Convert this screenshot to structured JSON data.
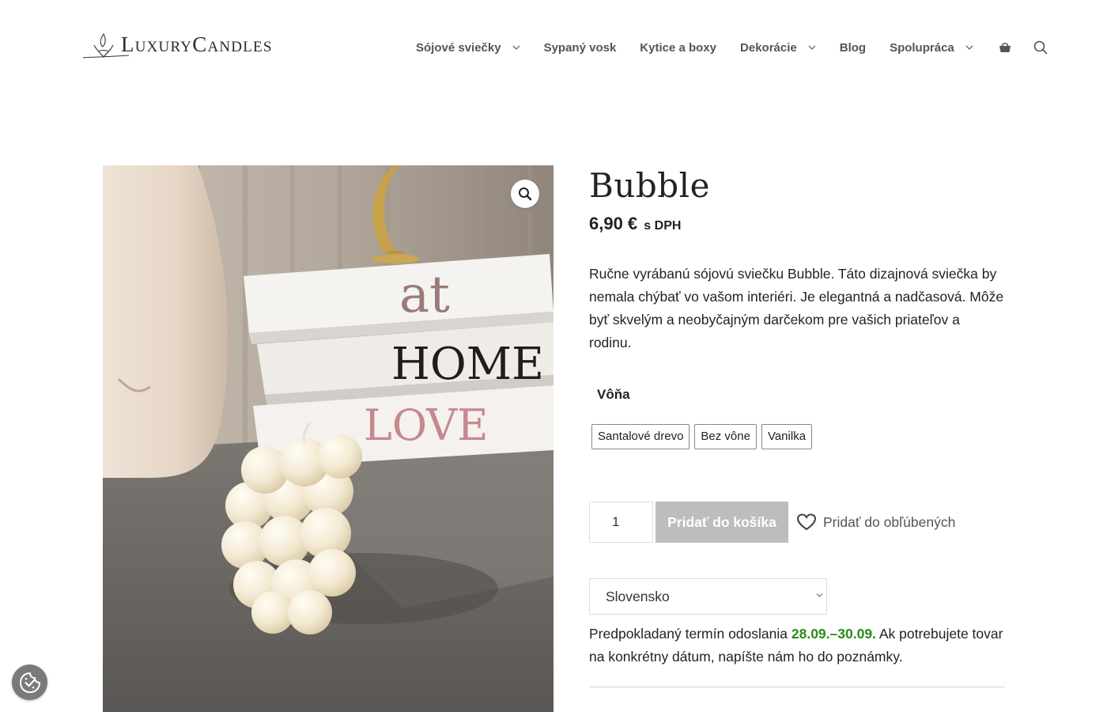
{
  "brand": {
    "logo_text": "LuxuryCandles"
  },
  "nav": {
    "items": [
      {
        "label": "Sójové sviečky",
        "has_dropdown": true
      },
      {
        "label": "Sypaný vosk",
        "has_dropdown": false
      },
      {
        "label": "Kytice a boxy",
        "has_dropdown": false
      },
      {
        "label": "Dekorácie",
        "has_dropdown": true
      },
      {
        "label": "Blog",
        "has_dropdown": false
      },
      {
        "label": "Spolupráca",
        "has_dropdown": true
      }
    ],
    "icons": [
      "shopping-basket-icon",
      "search-icon"
    ]
  },
  "product": {
    "title": "Bubble",
    "price": "6,90 €",
    "price_suffix": "s DPH",
    "description": "Ručne vyrábanú sójovú sviečku Bubble. Táto dizajnová sviečka by nemala chýbať vo vašom interiéri. Je elegantná a nadčasová. Môže byť skvelým a neobyčajným darčekom pre vašich priateľov a rodinu.",
    "image": {
      "book_texts": [
        "at",
        "HOME",
        "LOVE"
      ],
      "zoom_icon": "magnifier-icon"
    },
    "attribute": {
      "label": "Vôňa",
      "options": [
        "Santalové drevo",
        "Bez vône",
        "Vanilka"
      ]
    },
    "quantity": "1",
    "add_to_cart_label": "Pridať do košíka",
    "wishlist_label": "Pridať do obľúbených",
    "country_selected": "Slovensko",
    "shipping": {
      "prefix": "Predpokladaný termín odoslania",
      "dates": "28.09.–30.09.",
      "suffix": "Ak potrebujete tovar na konkrétny dátum, napíšte nám ho do poznámky."
    }
  },
  "colors": {
    "accent_green": "#2c8a1b",
    "button_disabled": "#bdbdbd",
    "nav_text": "#555555"
  }
}
